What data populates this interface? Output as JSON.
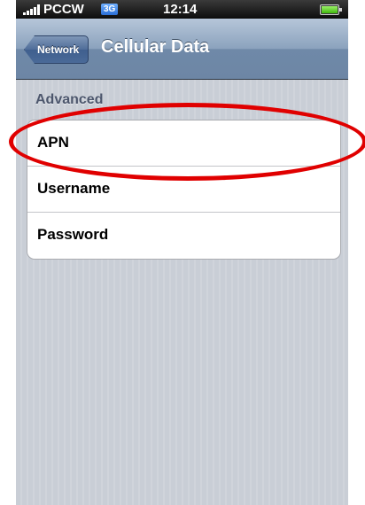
{
  "status_bar": {
    "carrier": "PCCW",
    "network_badge": "3G",
    "time": "12:14"
  },
  "navbar": {
    "back_label": "Network",
    "title": "Cellular Data"
  },
  "section": {
    "header": "Advanced",
    "rows": [
      {
        "label": "APN"
      },
      {
        "label": "Username"
      },
      {
        "label": "Password"
      }
    ]
  },
  "annotation": {
    "color": "#e00000",
    "target": "APN"
  }
}
